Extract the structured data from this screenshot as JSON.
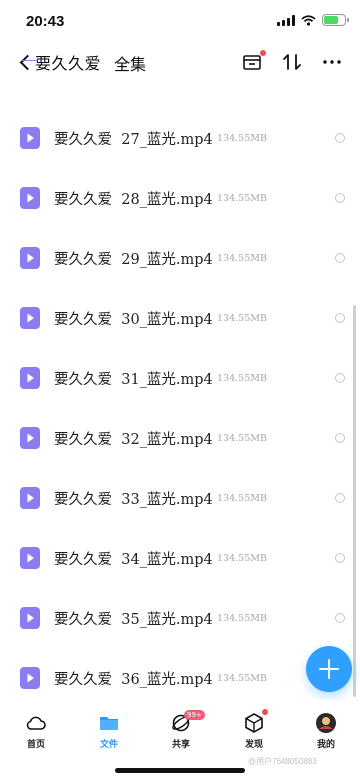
{
  "status_bar": {
    "time": "20:43"
  },
  "nav": {
    "folder": "要久久爱",
    "select_all": "全集",
    "icons": [
      "inbox-icon",
      "sort-icon",
      "more-icon"
    ]
  },
  "files": [
    {
      "name": "要久久爱  27_蓝光.mp4",
      "size": "134.55MB"
    },
    {
      "name": "要久久爱  28_蓝光.mp4",
      "size": "134.55MB"
    },
    {
      "name": "要久久爱  29_蓝光.mp4",
      "size": "134.55MB"
    },
    {
      "name": "要久久爱  30_蓝光.mp4",
      "size": "134.55MB"
    },
    {
      "name": "要久久爱  31_蓝光.mp4",
      "size": "134.55MB"
    },
    {
      "name": "要久久爱  32_蓝光.mp4",
      "size": "134.55MB"
    },
    {
      "name": "要久久爱  33_蓝光.mp4",
      "size": "134.55MB"
    },
    {
      "name": "要久久爱  34_蓝光.mp4",
      "size": "134.55MB"
    },
    {
      "name": "要久久爱  35_蓝光.mp4",
      "size": "134.55MB"
    },
    {
      "name": "要久久爱  36_蓝光.mp4",
      "size": "134.55MB"
    }
  ],
  "tabs": [
    {
      "label": "首页",
      "icon": "cloud-icon"
    },
    {
      "label": "文件",
      "icon": "folder-icon",
      "active": true
    },
    {
      "label": "共享",
      "icon": "share-icon",
      "badge": "99+"
    },
    {
      "label": "发现",
      "icon": "cube-icon"
    },
    {
      "label": "我的",
      "icon": "avatar"
    }
  ],
  "watermark": "@用户7648050883",
  "colors": {
    "accent": "#2f97f5",
    "video_icon": "#8a7df0",
    "notification_dot": "#f24b4b"
  }
}
